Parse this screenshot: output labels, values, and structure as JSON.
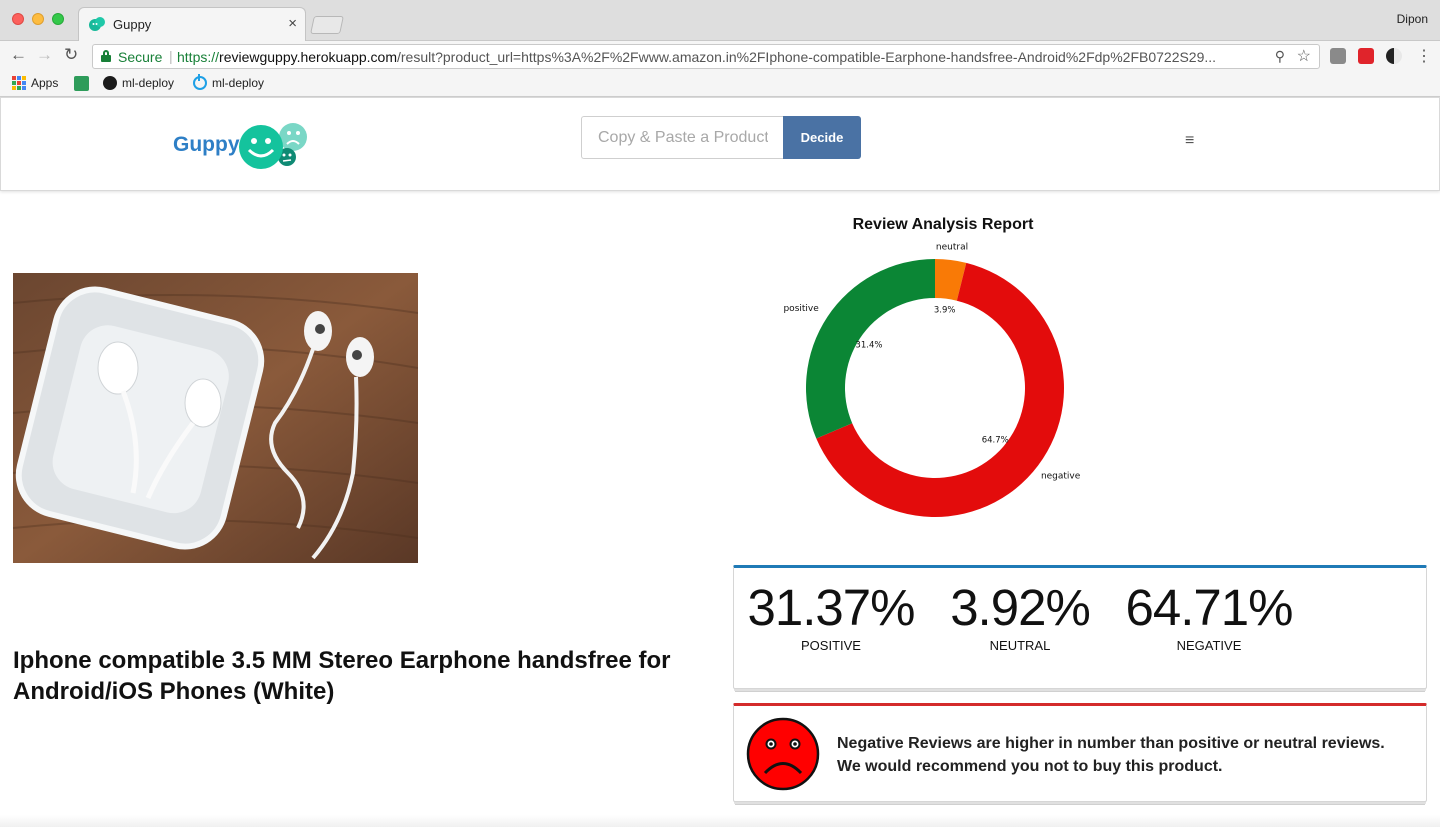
{
  "browser": {
    "tab_title": "Guppy",
    "tab_close": "×",
    "profile_name": "Dipon",
    "secure_label": "Secure",
    "url_scheme": "https://",
    "url_host": "reviewguppy.herokuapp.com",
    "url_path": "/result?product_url=https%3A%2F%2Fwww.amazon.in%2FIphone-compatible-Earphone-handsfree-Android%2Fdp%2FB0722S29...",
    "bookmarks": [
      {
        "label": "Apps"
      },
      {
        "label": ""
      },
      {
        "label": "ml-deploy"
      },
      {
        "label": "ml-deploy"
      }
    ]
  },
  "header": {
    "logo_text": "Guppy",
    "search_placeholder": "Copy & Paste a Product",
    "decide_label": "Decide",
    "menu_icon": "≡"
  },
  "product": {
    "title": "Iphone compatible 3.5 MM Stereo Earphone handsfree for Android/iOS Phones (White)"
  },
  "report": {
    "title": "Review Analysis Report"
  },
  "chart_data": {
    "type": "pie",
    "title": "Review Analysis Report",
    "categories": [
      "positive",
      "neutral",
      "negative"
    ],
    "values": [
      31.4,
      3.9,
      64.7
    ],
    "value_labels": [
      "31.4%",
      "3.9%",
      "64.7%"
    ],
    "colors": [
      "#0b8635",
      "#f97a06",
      "#e30c0c"
    ],
    "donut": true
  },
  "stats": [
    {
      "value": "31.37%",
      "label": "POSITIVE"
    },
    {
      "value": "3.92%",
      "label": "NEUTRAL"
    },
    {
      "value": "64.71%",
      "label": "NEGATIVE"
    }
  ],
  "recommendation": {
    "text": "Negative Reviews are higher in number than positive or neutral reviews. We would recommend you not to buy this product.",
    "icon": "sad-face-icon",
    "accent_color": "#d42b2b"
  }
}
